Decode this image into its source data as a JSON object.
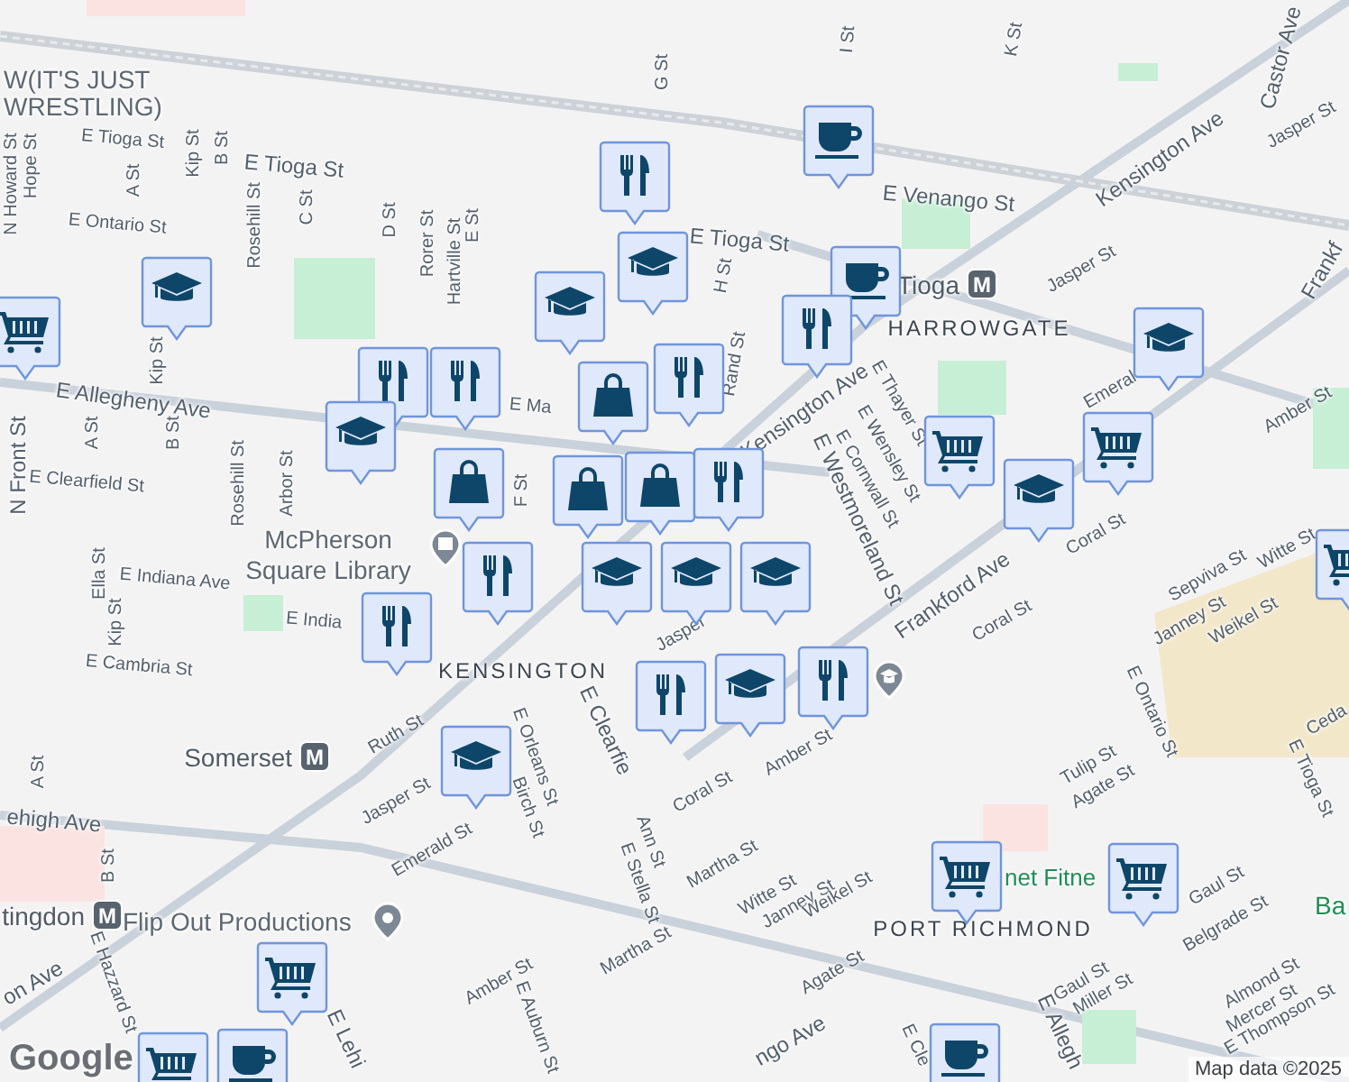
{
  "streets": [
    "E Tioga St",
    "E Tioga St",
    "E Ontario St",
    "N Howard St",
    "Hope St",
    "A St",
    "Kip St",
    "B St",
    "Rosehill St",
    "C St",
    "D St",
    "Rorer St",
    "Hartville St",
    "E St",
    "G St",
    "Kip St",
    "E Allegheny Ave",
    "A St",
    "B St",
    "Rosehill St",
    "Arbor St",
    "E Clearfield St",
    "N Front St",
    "E Ma",
    "F St",
    "Ella St",
    "E Indiana Ave",
    "Kip St",
    "E India",
    "E Cambria St",
    "Ruth St",
    "E Orleans St",
    "Birch St",
    "Jasper St",
    "Emerald St",
    "Ann St",
    "E Stella St",
    "Martha St",
    "B St",
    "A St",
    "ehigh Ave",
    "Amber St",
    "E Auburn St",
    "E Hazzard St",
    "on Ave",
    "E Lehi",
    "Kensington Ave",
    "Kensington Ave",
    "Castor Ave",
    "Jasper St",
    "Frankf",
    "E Venango St",
    "E Tioga St",
    "I St",
    "K St",
    "H St",
    "Rand St",
    "Jasper St",
    "E Thayer St",
    "E Wensley St",
    "E Cornwall St",
    "E Westmoreland St",
    "Emeral",
    "Amber St",
    "Coral St",
    "Coral St",
    "Frankford Ave",
    "Sepviva St",
    "Witte St",
    "Janney St",
    "Weikel St",
    "E Ontario St",
    "E Tioga St",
    "Tulip St",
    "Agate St",
    "Amber St",
    "Coral St",
    "Martha St",
    "Witte St",
    "Janney St",
    "Weikel St",
    "Agate St",
    "Gaul St",
    "Belgrade St",
    "Gaul St",
    "Miller St",
    "Almond St",
    "Mercer St",
    "E Thompson St",
    "E Allegh",
    "E Cle",
    "ngo Ave",
    "E Clearfie",
    "Jasper",
    "Ceda"
  ],
  "areas": [
    "HARROWGATE",
    "KENSINGTON",
    "PORT RICHMOND"
  ],
  "places": [
    {
      "name": "W(IT'S JUST WRESTLING)",
      "kind": "venue"
    },
    {
      "name": "McPherson Square Library",
      "kind": "library"
    },
    {
      "name": "Flip Out Productions",
      "kind": "venue"
    },
    {
      "name": "net Fitne",
      "kind": "fitness"
    },
    {
      "name": "Ba",
      "kind": "fitness"
    }
  ],
  "stations": [
    {
      "name": "Tioga",
      "badge": "M"
    },
    {
      "name": "Somerset",
      "badge": "M"
    },
    {
      "name": "tingdon",
      "badge": "M"
    }
  ],
  "markers": [
    {
      "kind": "cafe"
    },
    {
      "kind": "restaurant"
    },
    {
      "kind": "school"
    },
    {
      "kind": "school"
    },
    {
      "kind": "cafe"
    },
    {
      "kind": "restaurant"
    },
    {
      "kind": "shop"
    },
    {
      "kind": "grocery"
    },
    {
      "kind": "school"
    },
    {
      "kind": "school"
    },
    {
      "kind": "restaurant"
    },
    {
      "kind": "restaurant"
    },
    {
      "kind": "school"
    },
    {
      "kind": "restaurant"
    },
    {
      "kind": "shop"
    },
    {
      "kind": "shop"
    },
    {
      "kind": "shop"
    },
    {
      "kind": "restaurant"
    },
    {
      "kind": "grocery"
    },
    {
      "kind": "grocery"
    },
    {
      "kind": "school"
    },
    {
      "kind": "grocery"
    },
    {
      "kind": "restaurant"
    },
    {
      "kind": "school"
    },
    {
      "kind": "school"
    },
    {
      "kind": "school"
    },
    {
      "kind": "restaurant"
    },
    {
      "kind": "school"
    },
    {
      "kind": "restaurant"
    },
    {
      "kind": "restaurant"
    },
    {
      "kind": "school"
    },
    {
      "kind": "grocery"
    },
    {
      "kind": "grocery"
    },
    {
      "kind": "grocery"
    },
    {
      "kind": "cafe"
    },
    {
      "kind": "grocery"
    },
    {
      "kind": "cafe"
    }
  ],
  "logo": "Google",
  "attribution": "Map data ©2025"
}
